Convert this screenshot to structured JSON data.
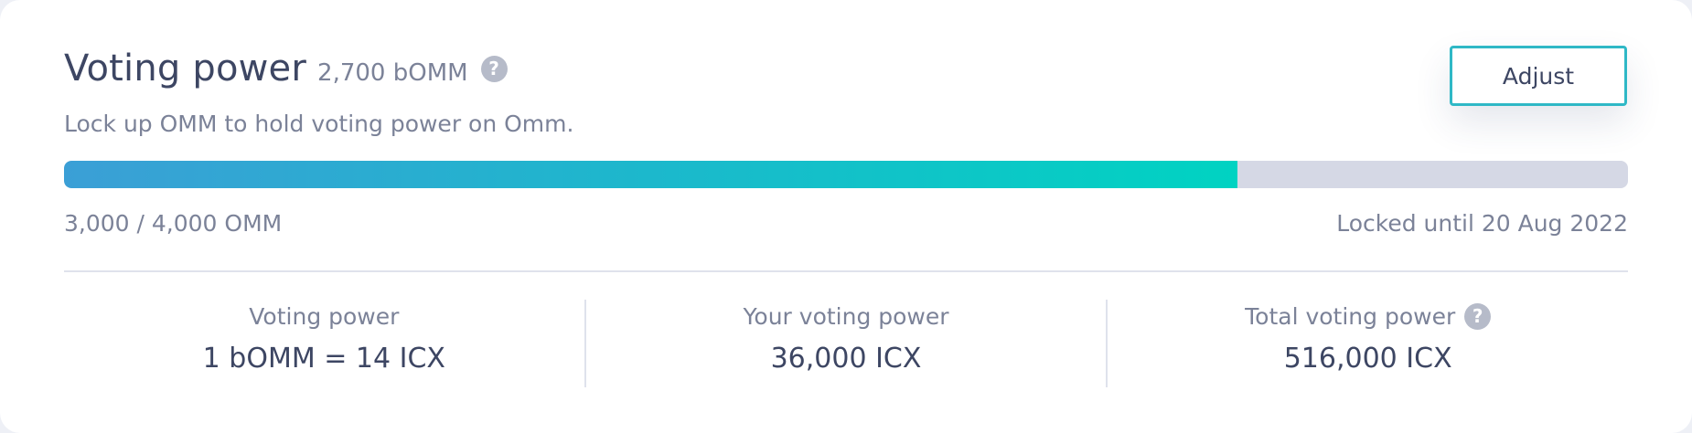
{
  "header": {
    "title": "Voting power",
    "balance": "2,700 bOMM",
    "help_icon": "?"
  },
  "adjust_label": "Adjust",
  "description": "Lock up OMM to hold voting power on Omm.",
  "progress": {
    "fraction": 0.75,
    "amount_text": "3,000 / 4,000 OMM",
    "locked_text": "Locked until 20 Aug 2022"
  },
  "stats": [
    {
      "label": "Voting power",
      "value": "1 bOMM = 14 ICX"
    },
    {
      "label": "Your voting power",
      "value": "36,000 ICX"
    },
    {
      "label": "Total voting power",
      "value": "516,000 ICX",
      "help_icon": "?"
    }
  ],
  "colors": {
    "accent": "#2fb8c6",
    "bar_start": "#3b9fd6",
    "bar_end": "#00d3c2",
    "track": "#d5d8e5",
    "text_dark": "#3d4663",
    "text_muted": "#7b8298"
  }
}
